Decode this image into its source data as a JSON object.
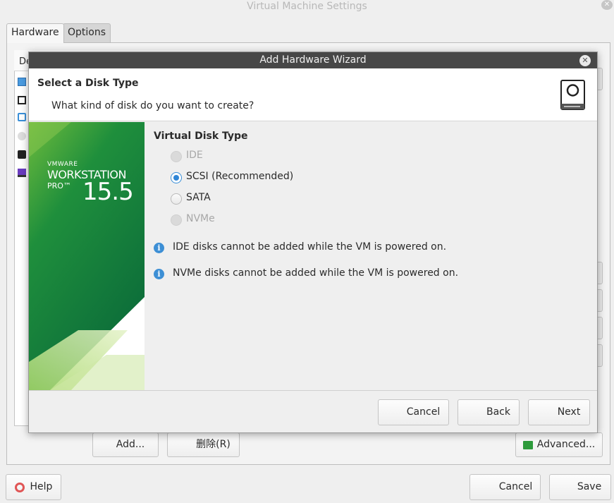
{
  "window": {
    "title": "Virtual Machine Settings",
    "tabs": [
      "Hardware",
      "Options"
    ],
    "device_header": "De",
    "buttons": {
      "add": "Add...",
      "remove": "删除(R)",
      "advanced": "Advanced...",
      "help": "Help",
      "cancel": "Cancel",
      "save": "Save"
    }
  },
  "wizard": {
    "title": "Add Hardware Wizard",
    "header_title": "Select a Disk Type",
    "header_subtitle": "What kind of disk do you want to create?",
    "banner": {
      "brand": "VMWARE",
      "product": "WORKSTATION",
      "edition": "PRO™",
      "version": "15.5"
    },
    "section_title": "Virtual Disk Type",
    "options": [
      {
        "label": "IDE",
        "enabled": false,
        "selected": false
      },
      {
        "label": "SCSI (Recommended)",
        "enabled": true,
        "selected": true
      },
      {
        "label": "SATA",
        "enabled": true,
        "selected": false
      },
      {
        "label": "NVMe",
        "enabled": false,
        "selected": false
      }
    ],
    "info_messages": [
      "IDE disks cannot be added while the VM is powered on.",
      "NVMe disks cannot be added while the VM is powered on."
    ],
    "buttons": {
      "cancel": "Cancel",
      "back": "Back",
      "next": "Next"
    }
  },
  "colors": {
    "accent": "#2f86d6",
    "titlebar": "#474747",
    "banner_green": "#1e8a3a"
  }
}
